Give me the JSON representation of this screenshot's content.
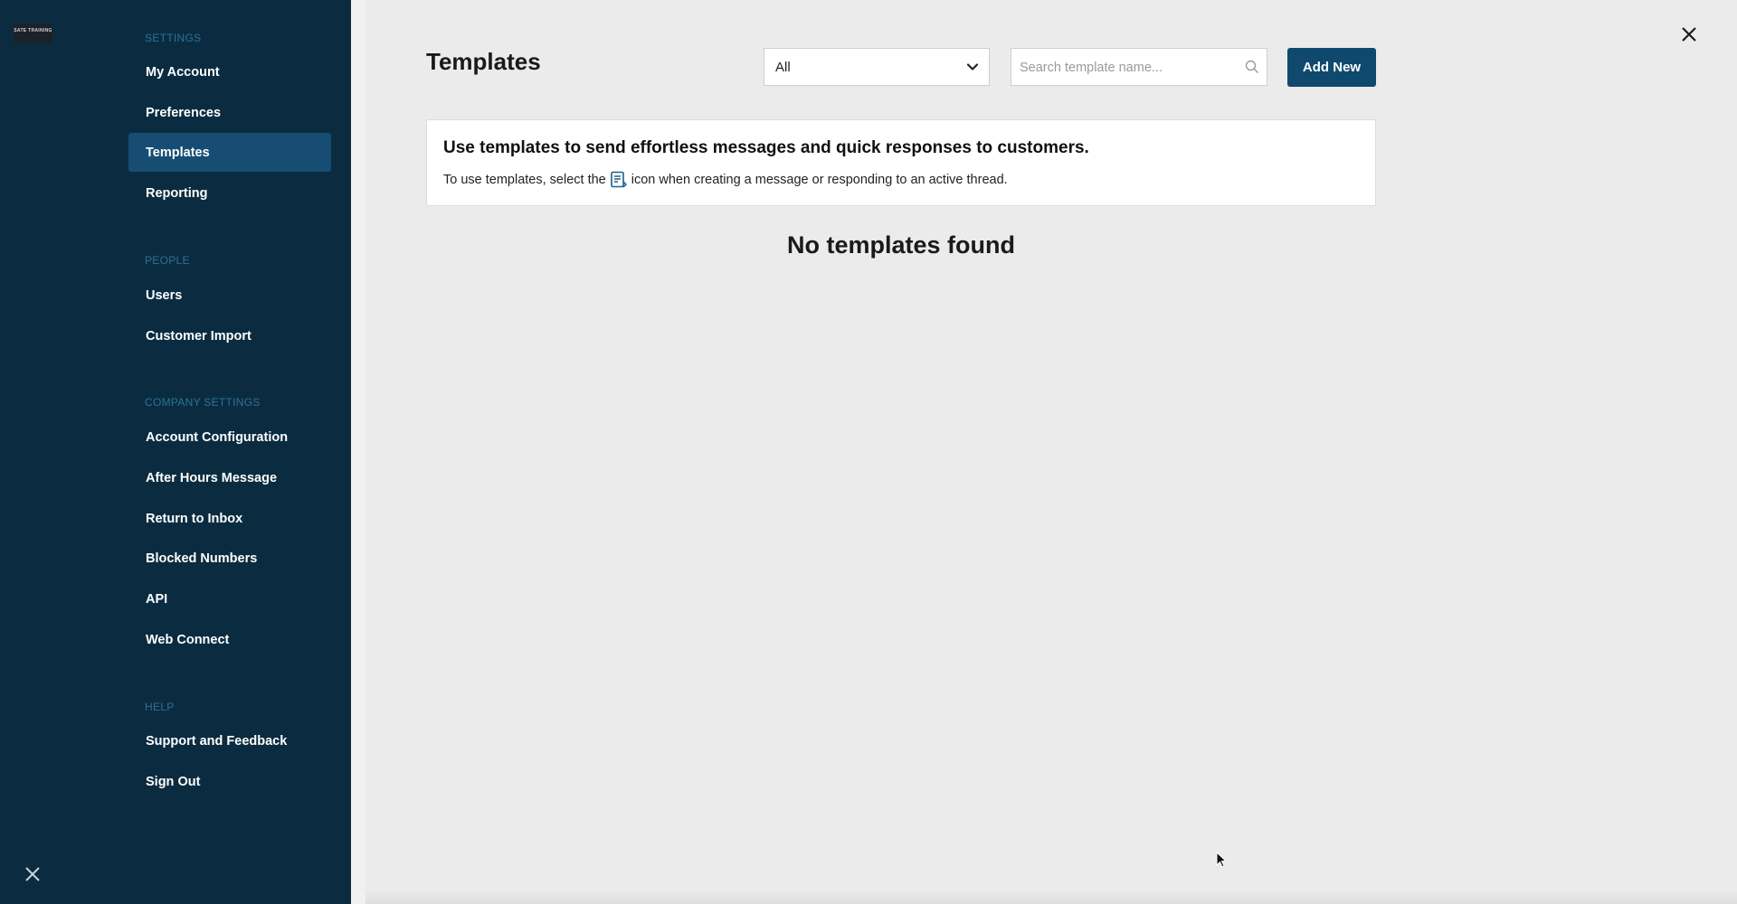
{
  "rail": {
    "logo_text": "SATE TRAINING"
  },
  "sidebar": {
    "sections": [
      {
        "title": "SETTINGS",
        "items": [
          {
            "label": "My Account"
          },
          {
            "label": "Preferences"
          },
          {
            "label": "Templates",
            "active": true
          },
          {
            "label": "Reporting"
          }
        ]
      },
      {
        "title": "PEOPLE",
        "items": [
          {
            "label": "Users"
          },
          {
            "label": "Customer Import"
          }
        ]
      },
      {
        "title": "COMPANY SETTINGS",
        "items": [
          {
            "label": "Account Configuration"
          },
          {
            "label": "After Hours Message"
          },
          {
            "label": "Return to Inbox"
          },
          {
            "label": "Blocked Numbers"
          },
          {
            "label": "API"
          },
          {
            "label": "Web Connect"
          }
        ]
      },
      {
        "title": "HELP",
        "items": [
          {
            "label": "Support and Feedback"
          },
          {
            "label": "Sign Out"
          }
        ]
      }
    ]
  },
  "main": {
    "title": "Templates",
    "filter": {
      "selected": "All"
    },
    "search": {
      "placeholder": "Search template name..."
    },
    "add_button": "Add New",
    "info": {
      "heading": "Use templates to send effortless messages and quick responses to customers.",
      "text_before": "To use templates, select the",
      "icon": "template-icon",
      "text_after": "icon when creating a message or responding to an active thread."
    },
    "empty_message": "No templates found"
  },
  "colors": {
    "sidebar_bg": "#0b2c40",
    "active_item_bg": "#174d72",
    "section_title": "#2e6f9b",
    "primary_button": "#0f4a6e",
    "main_bg": "#ebebeb"
  }
}
